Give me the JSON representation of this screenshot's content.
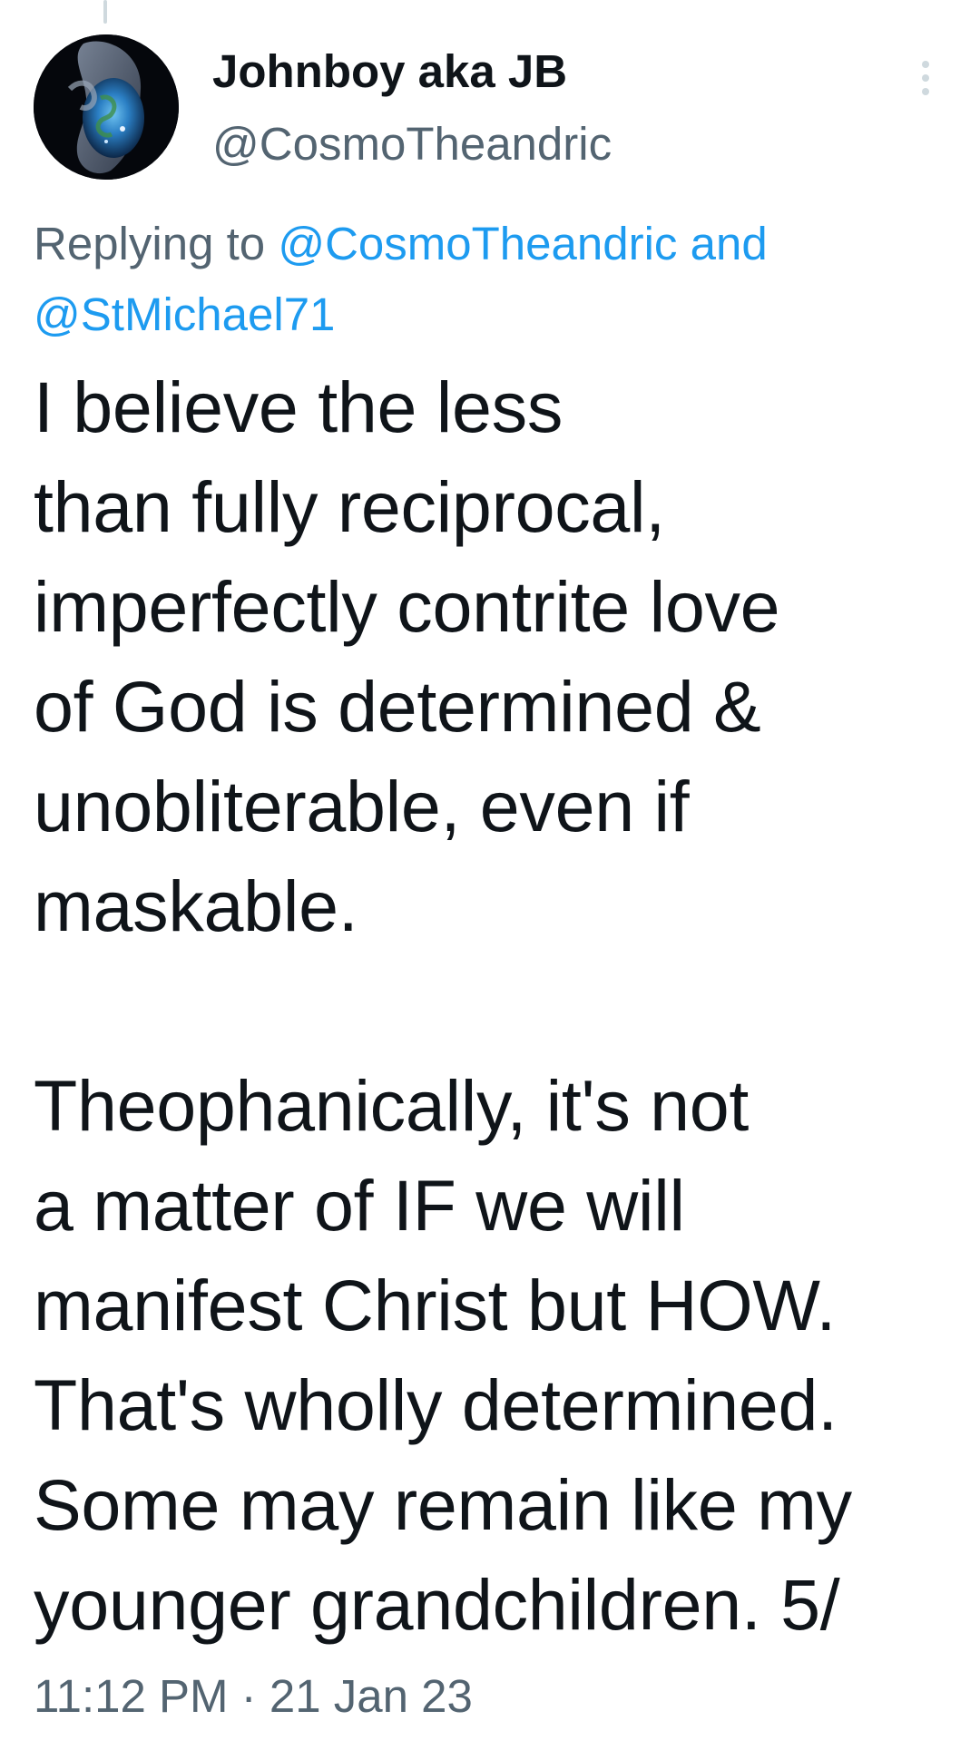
{
  "tweet": {
    "author": {
      "display_name": "Johnboy aka JB",
      "handle": "@CosmoTheandric"
    },
    "reply_context": {
      "prefix": "Replying to",
      "mentions": [
        "@CosmoTheandric",
        "@StMichael71"
      ],
      "conjunction": "and"
    },
    "text": "I believe the less\nthan fully reciprocal,\nimperfectly contrite love\nof God is determined &\nunobliterable, even if\nmaskable.\n\nTheophanically, it's not\na matter of IF we will\nmanifest Christ but HOW.\nThat's wholly determined.\nSome may remain like my\nyounger grandchildren. 5/",
    "timestamp": "11:12 PM · 21 Jan 23"
  },
  "icons": {
    "more": "more-vertical-icon"
  },
  "colors": {
    "link": "#1d9bf0",
    "secondary_text": "#536471",
    "primary_text": "#0f1419",
    "background": "#ffffff",
    "thread_line": "#cfd9de"
  }
}
